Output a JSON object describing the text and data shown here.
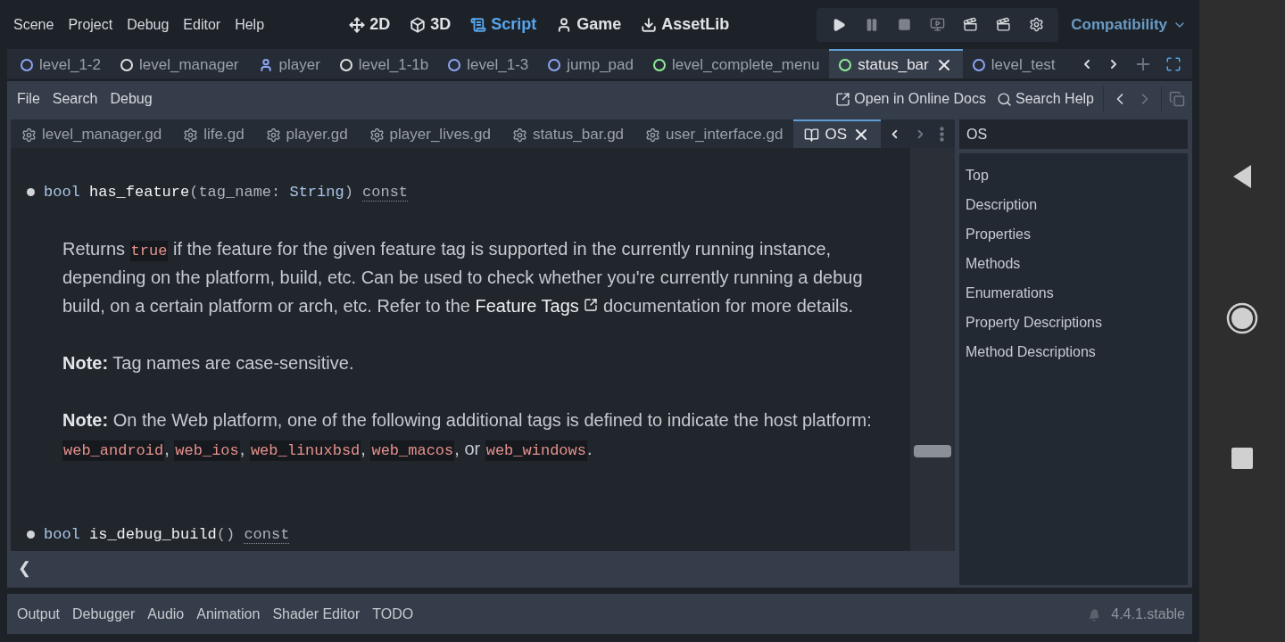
{
  "menu": [
    "Scene",
    "Project",
    "Debug",
    "Editor",
    "Help"
  ],
  "workspaces": [
    {
      "label": "2D",
      "kind": "planar",
      "selected": false
    },
    {
      "label": "3D",
      "kind": "spatial",
      "selected": false
    },
    {
      "label": "Script",
      "kind": "script",
      "selected": true
    },
    {
      "label": "Game",
      "kind": "game",
      "selected": false
    },
    {
      "label": "AssetLib",
      "kind": "assetlib",
      "selected": false
    }
  ],
  "renderer": "Compatibility",
  "scene_tabs": [
    {
      "label": "level_1-2",
      "kind": "node",
      "color": "#8da5f3",
      "selected": false
    },
    {
      "label": "level_manager",
      "kind": "node",
      "color": "#e0e0e0",
      "selected": false
    },
    {
      "label": "player",
      "kind": "body",
      "color": "#8da5f3",
      "selected": false
    },
    {
      "label": "level_1-1b",
      "kind": "node",
      "color": "#e0e0e0",
      "selected": false
    },
    {
      "label": "level_1-3",
      "kind": "node",
      "color": "#8da5f3",
      "selected": false
    },
    {
      "label": "jump_pad",
      "kind": "node",
      "color": "#8da5f3",
      "selected": false
    },
    {
      "label": "level_complete_menu",
      "kind": "node",
      "color": "#8eef97",
      "selected": false
    },
    {
      "label": "status_bar",
      "kind": "node",
      "color": "#8eef97",
      "selected": true
    },
    {
      "label": "level_test",
      "kind": "node",
      "color": "#8da5f3",
      "selected": false
    }
  ],
  "script_menu": [
    "File",
    "Search",
    "Debug"
  ],
  "help_buttons": [
    {
      "label": "Open in Online Docs",
      "kind": "docs"
    },
    {
      "label": "Search Help",
      "kind": "search"
    }
  ],
  "script_tabs": [
    {
      "label": "level_manager.gd",
      "kind": "script",
      "selected": false
    },
    {
      "label": "life.gd",
      "kind": "script",
      "selected": false
    },
    {
      "label": "player.gd",
      "kind": "script",
      "selected": false
    },
    {
      "label": "player_lives.gd",
      "kind": "script",
      "selected": false
    },
    {
      "label": "status_bar.gd",
      "kind": "script",
      "selected": false
    },
    {
      "label": "user_interface.gd",
      "kind": "script",
      "selected": false
    },
    {
      "label": "OS",
      "kind": "doc",
      "selected": true
    }
  ],
  "doc": {
    "entries": [
      {
        "signature": [
          {
            "text": "bool",
            "kind": "type"
          },
          {
            "text": "has_feature",
            "kind": "name"
          },
          {
            "text": "(tag_name: ",
            "kind": "punct"
          },
          {
            "text": "String",
            "kind": "type"
          },
          {
            "text": ")",
            "kind": "punct"
          },
          {
            "text": "const",
            "kind": "qualifier"
          }
        ],
        "paragraphs": [
          [
            {
              "text": "Returns ",
              "kind": "text"
            },
            {
              "text": "true",
              "kind": "code"
            },
            {
              "text": " if the feature for the given feature tag is supported in the currently running instance, depending on the platform, build, etc. Can be used to check whether you're currently running a debug build, on a certain platform or arch, etc. Refer to the ",
              "kind": "text"
            },
            {
              "text": "Feature Tags",
              "kind": "link"
            },
            {
              "text": " documentation for more details.",
              "kind": "text"
            }
          ],
          [
            {
              "text": "Note:",
              "kind": "bold"
            },
            {
              "text": " Tag names are case-sensitive.",
              "kind": "text"
            }
          ],
          [
            {
              "text": "Note:",
              "kind": "bold"
            },
            {
              "text": " On the Web platform, one of the following additional tags is defined to indicate the host platform: ",
              "kind": "text"
            },
            {
              "text": "web_android",
              "kind": "code"
            },
            {
              "text": ", ",
              "kind": "text"
            },
            {
              "text": "web_ios",
              "kind": "code"
            },
            {
              "text": ", ",
              "kind": "text"
            },
            {
              "text": "web_linuxbsd",
              "kind": "code"
            },
            {
              "text": ", ",
              "kind": "text"
            },
            {
              "text": "web_macos",
              "kind": "code"
            },
            {
              "text": ", or ",
              "kind": "text"
            },
            {
              "text": "web_windows",
              "kind": "code"
            },
            {
              "text": ".",
              "kind": "text"
            }
          ]
        ]
      },
      {
        "signature": [
          {
            "text": "bool",
            "kind": "type"
          },
          {
            "text": "is_debug_build",
            "kind": "name"
          },
          {
            "text": "()",
            "kind": "punct"
          },
          {
            "text": "const",
            "kind": "qualifier"
          }
        ]
      }
    ]
  },
  "collapse_arrow": "❮",
  "search": {
    "value": "OS"
  },
  "outline": [
    "Top",
    "Description",
    "Properties",
    "Methods",
    "Enumerations",
    "Property Descriptions",
    "Method Descriptions"
  ],
  "bottom_tabs": [
    "Output",
    "Debugger",
    "Audio",
    "Animation",
    "Shader Editor",
    "TODO"
  ],
  "version": "4.4.1.stable"
}
